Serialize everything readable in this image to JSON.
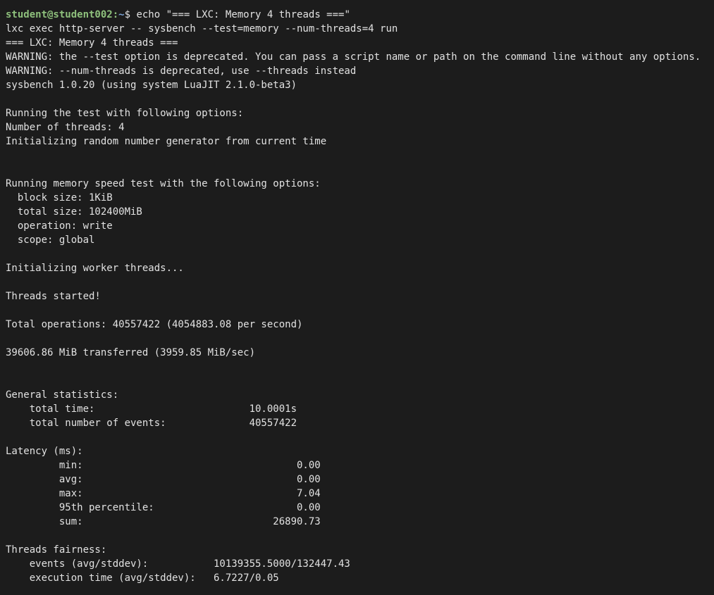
{
  "terminal": {
    "prompt": {
      "user_host": "student@student002",
      "separator": ":",
      "path": "~",
      "sigil": "$ ",
      "command": "echo \"=== LXC: Memory 4 threads ===\""
    },
    "lines": [
      "lxc exec http-server -- sysbench --test=memory --num-threads=4 run",
      "=== LXC: Memory 4 threads ===",
      "WARNING: the --test option is deprecated. You can pass a script name or path on the command line without any options.",
      "WARNING: --num-threads is deprecated, use --threads instead",
      "sysbench 1.0.20 (using system LuaJIT 2.1.0-beta3)",
      "",
      "Running the test with following options:",
      "Number of threads: 4",
      "Initializing random number generator from current time",
      "",
      "",
      "Running memory speed test with the following options:",
      "  block size: 1KiB",
      "  total size: 102400MiB",
      "  operation: write",
      "  scope: global",
      "",
      "Initializing worker threads...",
      "",
      "Threads started!",
      "",
      "Total operations: 40557422 (4054883.08 per second)",
      "",
      "39606.86 MiB transferred (3959.85 MiB/sec)",
      "",
      "",
      "General statistics:",
      "    total time:                          10.0001s",
      "    total number of events:              40557422",
      "",
      "Latency (ms):",
      "         min:                                    0.00",
      "         avg:                                    0.00",
      "         max:                                    7.04",
      "         95th percentile:                        0.00",
      "         sum:                                26890.73",
      "",
      "Threads fairness:",
      "    events (avg/stddev):           10139355.5000/132447.43",
      "    execution time (avg/stddev):   6.7227/0.05"
    ]
  }
}
